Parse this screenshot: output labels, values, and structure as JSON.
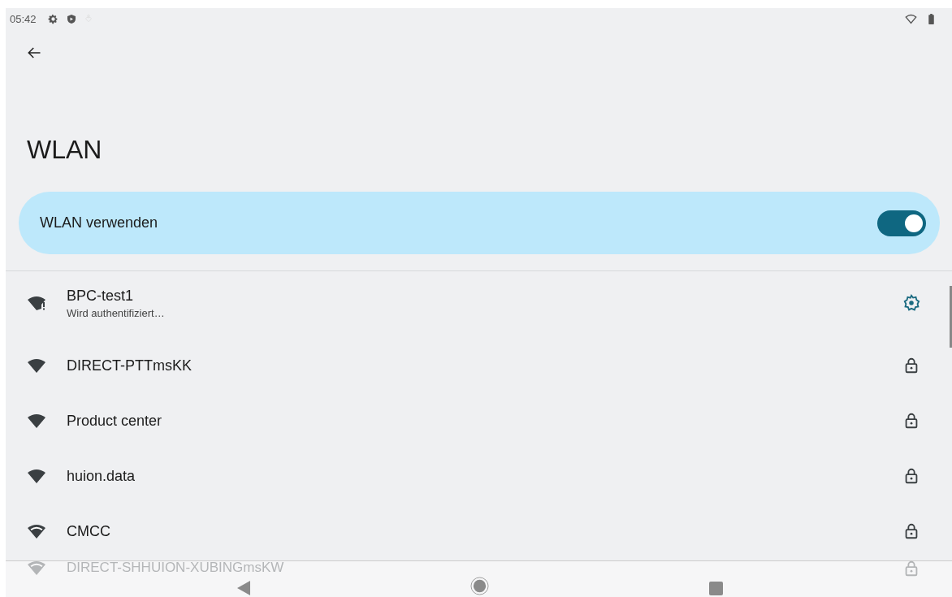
{
  "status_bar": {
    "time": "05:42"
  },
  "title": "WLAN",
  "wlan_toggle": {
    "label": "WLAN verwenden",
    "on": true
  },
  "networks": [
    {
      "name": "BPC-test1",
      "status": "Wird authentifiziert…",
      "kind": "connecting",
      "obscured": false
    },
    {
      "name": "DIRECT-PTTmsKK",
      "kind": "secured",
      "obscured": false
    },
    {
      "name": "Product center",
      "kind": "secured",
      "obscured": false
    },
    {
      "name": "huion.data",
      "kind": "secured",
      "obscured": false
    },
    {
      "name": "CMCC",
      "kind": "secured_weak",
      "obscured": false
    },
    {
      "name": "DIRECT-SHHUION-XUBINGmsKW",
      "kind": "secured_weak",
      "obscured": true
    }
  ]
}
